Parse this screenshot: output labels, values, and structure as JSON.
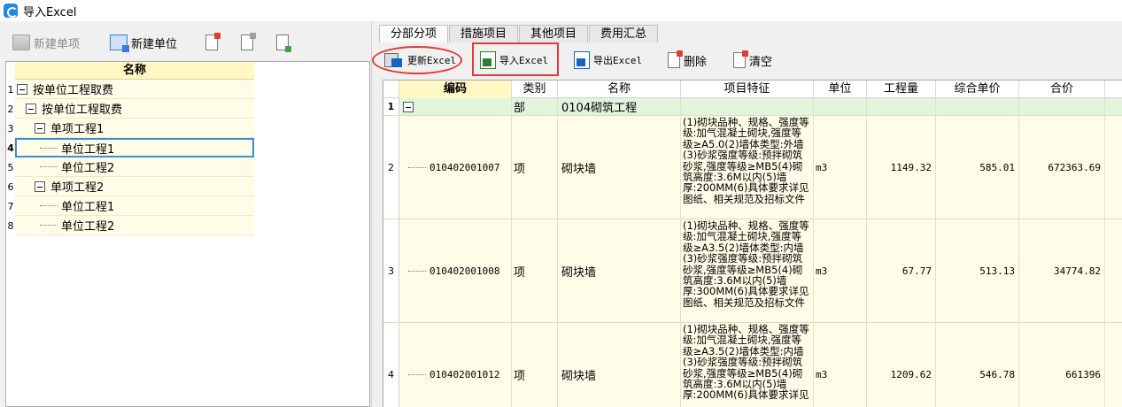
{
  "window": {
    "title": "导入Excel"
  },
  "left_toolbar": {
    "new_item_label": "新建单项",
    "new_unit_label": "新建单位"
  },
  "tree": {
    "header": "名称",
    "rows": [
      {
        "num": "1",
        "label": "按单位工程取费"
      },
      {
        "num": "2",
        "label": "按单位工程取费"
      },
      {
        "num": "3",
        "label": "单项工程1"
      },
      {
        "num": "4",
        "label": "单位工程1"
      },
      {
        "num": "5",
        "label": "单位工程2"
      },
      {
        "num": "6",
        "label": "单项工程2"
      },
      {
        "num": "7",
        "label": "单位工程1"
      },
      {
        "num": "8",
        "label": "单位工程2"
      }
    ]
  },
  "tabs": [
    {
      "label": "分部分项"
    },
    {
      "label": "措施项目"
    },
    {
      "label": "其他项目"
    },
    {
      "label": "费用汇总"
    }
  ],
  "right_toolbar": {
    "update_label": "更新Excel",
    "import_label": "导入Excel",
    "export_label": "导出Excel",
    "delete_label": "删除",
    "clear_label": "清空"
  },
  "grid": {
    "columns": [
      "编码",
      "类别",
      "名称",
      "项目特征",
      "单位",
      "工程量",
      "综合单价",
      "合价"
    ],
    "group_row": {
      "num": "1",
      "category": "部",
      "name": "0104砌筑工程"
    },
    "rows": [
      {
        "num": "2",
        "code": "010402001007",
        "category": "项",
        "name": "砌块墙",
        "feature": "(1)砌块品种、规格、强度等级:加气混凝土砌块,强度等级≥A5.0(2)墙体类型:外墙(3)砂浆强度等级:预拌砌筑砂浆,强度等级≥MB5(4)砌筑高度:3.6M以内(5)墙厚:200MM(6)具体要求详见图纸、相关规范及招标文件",
        "unit": "m3",
        "quantity": "1149.32",
        "unit_price": "585.01",
        "total": "672363.69"
      },
      {
        "num": "3",
        "code": "010402001008",
        "category": "项",
        "name": "砌块墙",
        "feature": "(1)砌块品种、规格、强度等级:加气混凝土砌块,强度等级≥A3.5(2)墙体类型:内墙(3)砂浆强度等级:预拌砌筑砂浆,强度等级≥MB5(4)砌筑高度:3.6M以内(5)墙厚:300MM(6)具体要求详见图纸、相关规范及招标文件",
        "unit": "m3",
        "quantity": "67.77",
        "unit_price": "513.13",
        "total": "34774.82"
      },
      {
        "num": "4",
        "code": "010402001012",
        "category": "项",
        "name": "砌块墙",
        "feature": "(1)砌块品种、规格、强度等级:加气混凝土砌块,强度等级≥A3.5(2)墙体类型:内墙(3)砂浆强度等级:预拌砌筑砂浆,强度等级≥MB5(4)砌筑高度:3.6M以内(5)墙厚:200MM(6)具体要求详见",
        "unit": "m3",
        "quantity": "1209.62",
        "unit_price": "546.78",
        "total": "661396"
      }
    ]
  },
  "colors": {
    "header_yellow": "#fff7c4",
    "row_yellow": "#fffde7",
    "group_green": "#e2f4dc",
    "annotation_red": "#e53935",
    "selection_blue": "#3a8fd9"
  }
}
